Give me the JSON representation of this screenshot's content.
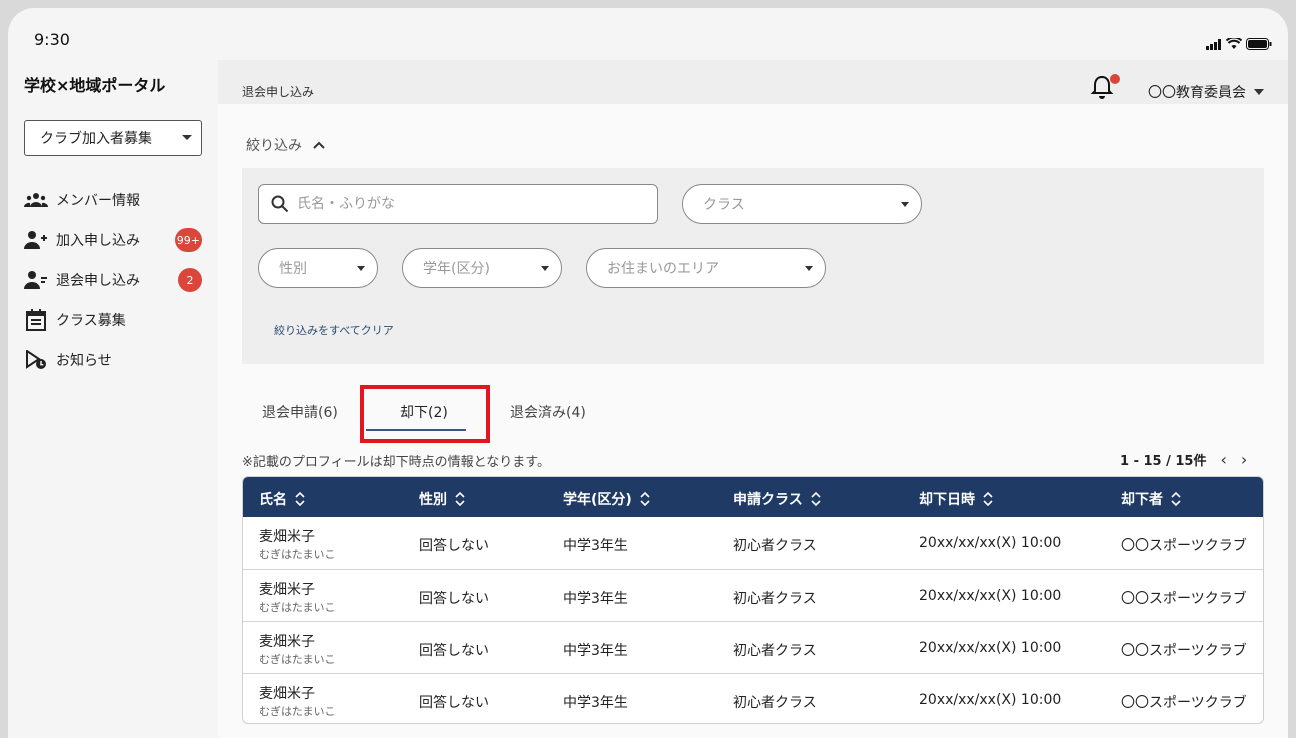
{
  "status": {
    "time": "9:30"
  },
  "app": {
    "title": "学校×地域ポータル"
  },
  "sidebar": {
    "club_select": "クラブ加入者募集",
    "items": [
      {
        "label": "メンバー情報",
        "icon": "group-icon",
        "badge": ""
      },
      {
        "label": "加入申し込み",
        "icon": "person-add-icon",
        "badge": "99+"
      },
      {
        "label": "退会申し込み",
        "icon": "person-remove-icon",
        "badge": "2"
      },
      {
        "label": "クラス募集",
        "icon": "calendar-icon",
        "badge": ""
      },
      {
        "label": "お知らせ",
        "icon": "notice-icon",
        "badge": ""
      }
    ]
  },
  "header": {
    "breadcrumb": "退会申し込み",
    "user": "〇〇教育委員会"
  },
  "filters": {
    "toggle_label": "絞り込み",
    "search_placeholder": "氏名・ふりがな",
    "class_placeholder": "クラス",
    "gender_placeholder": "性別",
    "grade_placeholder": "学年(区分)",
    "area_placeholder": "お住まいのエリア",
    "clear_label": "絞り込みをすべてクリア"
  },
  "tabs": [
    {
      "label": "退会申請(6)"
    },
    {
      "label": "却下(2)"
    },
    {
      "label": "退会済み(4)"
    }
  ],
  "note": "※記載のプロフィールは却下時点の情報となります。",
  "pager": {
    "range": "1 - 15 / 15件"
  },
  "table": {
    "headers": [
      "氏名",
      "性別",
      "学年(区分)",
      "申請クラス",
      "却下日時",
      "却下者"
    ],
    "rows": [
      {
        "name": "麦畑米子",
        "kana": "むぎはたまいこ",
        "gender": "回答しない",
        "grade": "中学3年生",
        "class": "初心者クラス",
        "date": "20xx/xx/xx(X) 10:00",
        "by": "〇〇スポーツクラブ"
      },
      {
        "name": "麦畑米子",
        "kana": "むぎはたまいこ",
        "gender": "回答しない",
        "grade": "中学3年生",
        "class": "初心者クラス",
        "date": "20xx/xx/xx(X) 10:00",
        "by": "〇〇スポーツクラブ"
      },
      {
        "name": "麦畑米子",
        "kana": "むぎはたまいこ",
        "gender": "回答しない",
        "grade": "中学3年生",
        "class": "初心者クラス",
        "date": "20xx/xx/xx(X) 10:00",
        "by": "〇〇スポーツクラブ"
      },
      {
        "name": "麦畑米子",
        "kana": "むぎはたまいこ",
        "gender": "回答しない",
        "grade": "中学3年生",
        "class": "初心者クラス",
        "date": "20xx/xx/xx(X) 10:00",
        "by": "〇〇スポーツクラブ"
      }
    ]
  },
  "colors": {
    "header_bg": "#1f3a64",
    "badge": "#d9463a",
    "highlight": "#e0171f",
    "tab_underline": "#3a5580"
  }
}
